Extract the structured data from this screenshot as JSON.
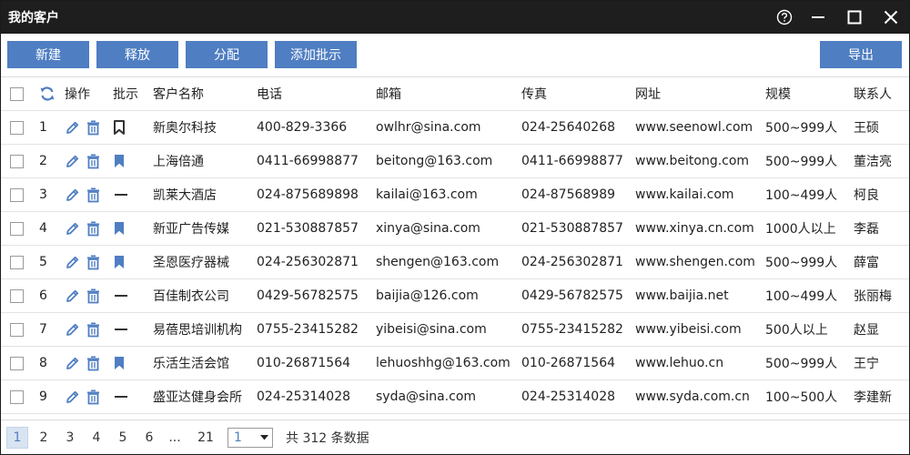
{
  "window": {
    "title": "我的客户"
  },
  "toolbar": {
    "new_label": "新建",
    "release_label": "释放",
    "assign_label": "分配",
    "approve_label": "添加批示",
    "export_label": "导出"
  },
  "table": {
    "headers": {
      "ops": "操作",
      "note": "批示",
      "name": "客户名称",
      "phone": "电话",
      "email": "邮箱",
      "fax": "传真",
      "web": "网址",
      "scale": "规模",
      "contact": "联系人"
    },
    "rows": [
      {
        "num": "1",
        "note": "bookmark-outline",
        "name": "新奥尔科技",
        "phone": "400-829-3366",
        "email": "owlhr@sina.com",
        "fax": "024-25640268",
        "web": "www.seenowl.com",
        "scale": "500~999人",
        "contact": "王硕"
      },
      {
        "num": "2",
        "note": "bookmark-filled",
        "name": "上海倍通",
        "phone": "0411-66998877",
        "email": "beitong@163.com",
        "fax": "0411-66998877",
        "web": "www.beitong.com",
        "scale": "500~999人",
        "contact": "董洁亮"
      },
      {
        "num": "3",
        "note": "dash",
        "name": "凯莱大酒店",
        "phone": "024-875689898",
        "email": "kailai@163.com",
        "fax": "024-87568989",
        "web": "www.kailai.com",
        "scale": "100~499人",
        "contact": "柯良"
      },
      {
        "num": "4",
        "note": "bookmark-filled",
        "name": "新亚广告传媒",
        "phone": "021-530887857",
        "email": "xinya@sina.com",
        "fax": "021-530887857",
        "web": "www.xinya.cn.com",
        "scale": "1000人以上",
        "contact": "李磊"
      },
      {
        "num": "5",
        "note": "bookmark-filled",
        "name": "圣恩医疗器械",
        "phone": "024-256302871",
        "email": "shengen@163.com",
        "fax": "024-256302871",
        "web": "www.shengen.com",
        "scale": "500~999人",
        "contact": "薛富"
      },
      {
        "num": "6",
        "note": "dash",
        "name": "百佳制衣公司",
        "phone": "0429-56782575",
        "email": "baijia@126.com",
        "fax": "0429-56782575",
        "web": "www.baijia.net",
        "scale": "100~499人",
        "contact": "张丽梅"
      },
      {
        "num": "7",
        "note": "dash",
        "name": "易蓓思培训机构",
        "phone": "0755-23415282",
        "email": "yibeisi@sina.com",
        "fax": "0755-23415282",
        "web": "www.yibeisi.com",
        "scale": "500人以上",
        "contact": "赵显"
      },
      {
        "num": "8",
        "note": "bookmark-filled",
        "name": "乐活生活会馆",
        "phone": "010-26871564",
        "email": "lehuoshhg@163.com",
        "fax": "010-26871564",
        "web": "www.lehuo.cn",
        "scale": "500~999人",
        "contact": "王宁"
      },
      {
        "num": "9",
        "note": "dash",
        "name": "盛亚达健身会所",
        "phone": "024-25314028",
        "email": "syda@sina.com",
        "fax": "024-25314028",
        "web": "www.syda.com.cn",
        "scale": "100~500人",
        "contact": "李建新"
      }
    ]
  },
  "pagination": {
    "pages": [
      "1",
      "2",
      "3",
      "4",
      "5",
      "6"
    ],
    "active_page": "1",
    "ellipsis": "...",
    "last_page": "21",
    "select_value": "1",
    "total_text": "共 312 条数据"
  },
  "colors": {
    "accent": "#4f7ec2",
    "titlebar": "#1e1e1e"
  }
}
